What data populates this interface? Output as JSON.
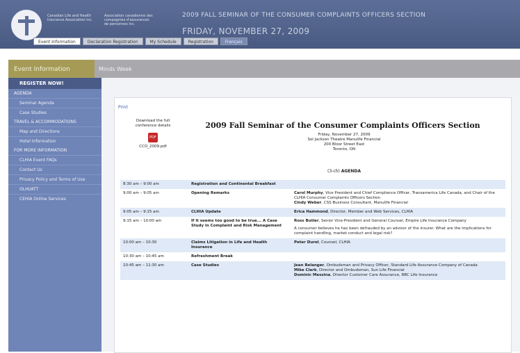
{
  "header": {
    "org_en": "Canadian Life and Health Insurance Association Inc.",
    "org_fr": "Association canadienne des compagnies d'assurances de personnes inc.",
    "event_title": "2009 FALL SEMINAR OF THE CONSUMER COMPLAINTS OFFICERS SECTION",
    "event_date": "FRIDAY, NOVEMBER 27, 2009"
  },
  "tabs": [
    "Event Information",
    "Declaration Registration",
    "My Schedule",
    "Registration",
    "Français"
  ],
  "section": {
    "left": "Event Information",
    "right": "Minds Week"
  },
  "sidebar": {
    "register": "REGISTER NOW!",
    "agenda": "AGENDA",
    "seminar_agenda": "Seminar Agenda",
    "case_studies": "Case Studies",
    "travel": "TRAVEL & ACCOMMODATIONS",
    "map": "Map and Directions",
    "hotel": "Hotel Information",
    "more_info": "FOR MORE INFORMATION",
    "faqs": "CLHIA Event FAQs",
    "contact": "Contact Us",
    "privacy": "Privacy Policy and Terms of Use",
    "olhi": "OLHI/ATT",
    "cehia": "CEHIA Online Services"
  },
  "content": {
    "print": "Print",
    "download_label": "Download the full conference details",
    "pdf_icon": "pdf-icon",
    "pdf_file": "CCO_2009.pdf",
    "title": "2009 Fall Seminar of the Consumer Complaints Officers Section",
    "venue_line1": "Friday, November 27, 2009",
    "venue_line2": "Sol Jackson Theatre Manulife Financial",
    "venue_line3": "200 Bloor Street East",
    "venue_line4": "Toronto, ON",
    "agenda_prefix": "(3-ch)",
    "agenda_link": "AGENDA"
  },
  "agenda_rows": [
    {
      "time": "8:30 am – 9:00 am",
      "topic": "Registration and Continental Breakfast",
      "speaker": "",
      "details": ""
    },
    {
      "time": "9:00 am – 9:05 am",
      "topic": "Opening Remarks",
      "speaker": "Carol Murphy",
      "details": ", Vice President and Chief Compliance Officer, Transamerica Life Canada, and Chair of the CLHIA Consumer Complaints Officers Section",
      "speaker2": "Cindy Weber",
      "details2": ", CSS Business Consultant, Manulife Financial"
    },
    {
      "time": "9:05 am – 9:15 am",
      "topic": "CLHIA Update",
      "speaker": "Erica Hammond",
      "details": ", Director, Member and Web Services, CLHIA"
    },
    {
      "time": "9:15 am – 10:00 am",
      "topic": "If it seems too good to be true... A Case Study in Complaint and Risk Management",
      "speaker": "Ross Butler",
      "details": ", Senior Vice-President and General Counsel, Empire Life Insurance Company",
      "note": "A consumer believes he has been defrauded by an advisor of the insurer. What are the implications for complaint handling, market conduct and legal risk?"
    },
    {
      "time": "10:00 am – 10:30",
      "topic": "Claims Litigation in Life and Health Insurance",
      "speaker": "Peter Durel",
      "details": ", Counsel, CLHIA"
    },
    {
      "time": "10:30 am – 10:45 am",
      "topic": "Refreshment Break",
      "speaker": "",
      "details": ""
    },
    {
      "time": "10:45 am – 11:30 am",
      "topic": "Case Studies",
      "speaker": "Jean Belanger",
      "details": ", Ombudsman and Privacy Officer, Standard Life Assurance Company of Canada",
      "speaker2": "Mike Clark",
      "details2": ", Director and Ombudsman, Sun Life Financial",
      "speaker3": "Dominic Messina",
      "details3": ", Director Customer Care Assurance, RBC Life Insurance"
    }
  ]
}
